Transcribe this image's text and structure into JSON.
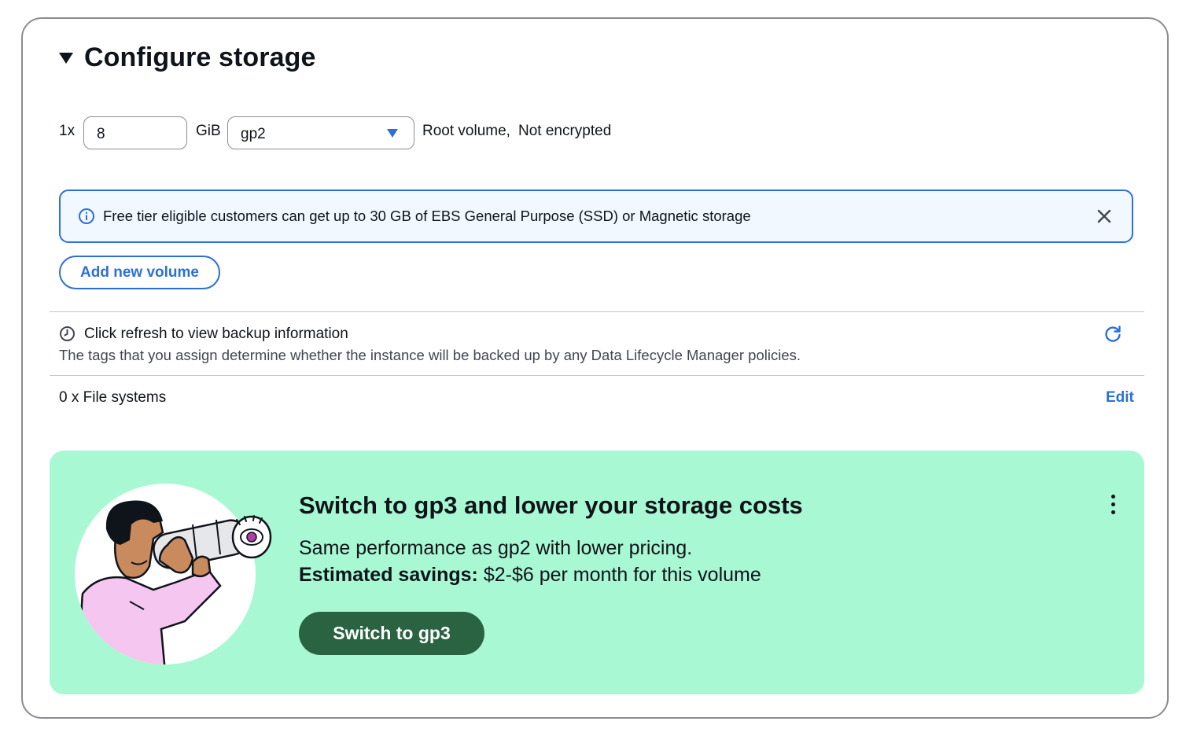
{
  "section": {
    "title": "Configure storage"
  },
  "volume": {
    "count_label": "1x",
    "size_value": "8",
    "unit_label": "GiB",
    "type_value": "gp2",
    "root_label": "Root volume,",
    "encryption_label": "Not encrypted"
  },
  "alert": {
    "text": "Free tier eligible customers can get up to 30 GB of EBS General Purpose (SSD) or Magnetic storage"
  },
  "add_volume_label": "Add new volume",
  "backup": {
    "title": "Click refresh to view backup information",
    "description": "The tags that you assign determine whether the instance will be backed up by any Data Lifecycle Manager policies."
  },
  "file_systems": {
    "label": "0 x File systems",
    "edit_label": "Edit"
  },
  "promo": {
    "title": "Switch to gp3 and lower your storage costs",
    "line1": "Same performance as gp2 with lower pricing.",
    "savings_label": "Estimated savings:",
    "savings_value": "$2-$6 per month for this volume",
    "button_label": "Switch to gp3",
    "background_color": "#a8f8d3",
    "button_color": "#2a6342"
  },
  "colors": {
    "accent": "#2d6fd9",
    "alert_bg": "#f1f8ff"
  }
}
